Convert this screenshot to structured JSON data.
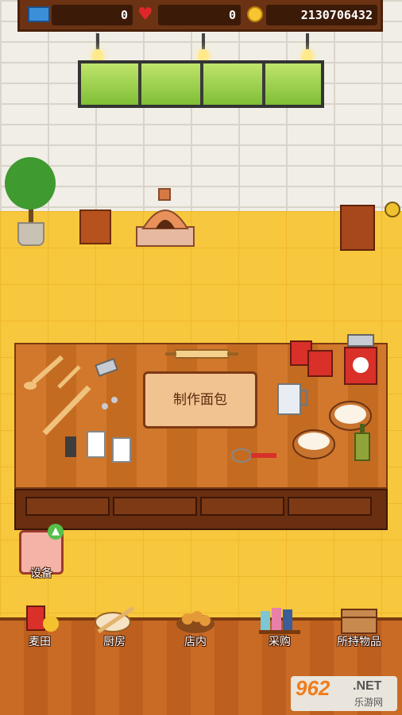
{
  "hud": {
    "tickets": "0",
    "hearts": "0",
    "coins": "2130706432"
  },
  "icons": {
    "ticket": "ticket-icon",
    "heart": "heart-icon",
    "coin": "coin-icon"
  },
  "main": {
    "make_bread_label": "制作面包"
  },
  "equipment": {
    "label": "设备"
  },
  "nav": [
    {
      "label": "麦田",
      "icon": "wheat-field-icon"
    },
    {
      "label": "厨房",
      "icon": "kitchen-icon"
    },
    {
      "label": "店内",
      "icon": "shop-icon"
    },
    {
      "label": "采购",
      "icon": "purchase-icon"
    },
    {
      "label": "所持物品",
      "icon": "inventory-icon"
    }
  ],
  "watermark": {
    "number": "962",
    "suffix": ".NET",
    "sub": "乐游网"
  },
  "colors": {
    "floor": "#f7c73d",
    "table": "#d2782c",
    "topbar": "#6b3313"
  }
}
